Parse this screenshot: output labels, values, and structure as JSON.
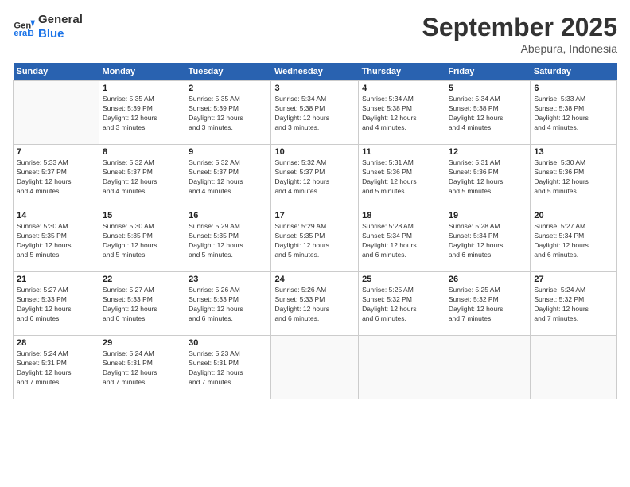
{
  "logo": {
    "line1": "General",
    "line2": "Blue"
  },
  "title": "September 2025",
  "subtitle": "Abepura, Indonesia",
  "days_of_week": [
    "Sunday",
    "Monday",
    "Tuesday",
    "Wednesday",
    "Thursday",
    "Friday",
    "Saturday"
  ],
  "weeks": [
    [
      {
        "day": "",
        "info": ""
      },
      {
        "day": "1",
        "info": "Sunrise: 5:35 AM\nSunset: 5:39 PM\nDaylight: 12 hours\nand 3 minutes."
      },
      {
        "day": "2",
        "info": "Sunrise: 5:35 AM\nSunset: 5:39 PM\nDaylight: 12 hours\nand 3 minutes."
      },
      {
        "day": "3",
        "info": "Sunrise: 5:34 AM\nSunset: 5:38 PM\nDaylight: 12 hours\nand 3 minutes."
      },
      {
        "day": "4",
        "info": "Sunrise: 5:34 AM\nSunset: 5:38 PM\nDaylight: 12 hours\nand 4 minutes."
      },
      {
        "day": "5",
        "info": "Sunrise: 5:34 AM\nSunset: 5:38 PM\nDaylight: 12 hours\nand 4 minutes."
      },
      {
        "day": "6",
        "info": "Sunrise: 5:33 AM\nSunset: 5:38 PM\nDaylight: 12 hours\nand 4 minutes."
      }
    ],
    [
      {
        "day": "7",
        "info": "Sunrise: 5:33 AM\nSunset: 5:37 PM\nDaylight: 12 hours\nand 4 minutes."
      },
      {
        "day": "8",
        "info": "Sunrise: 5:32 AM\nSunset: 5:37 PM\nDaylight: 12 hours\nand 4 minutes."
      },
      {
        "day": "9",
        "info": "Sunrise: 5:32 AM\nSunset: 5:37 PM\nDaylight: 12 hours\nand 4 minutes."
      },
      {
        "day": "10",
        "info": "Sunrise: 5:32 AM\nSunset: 5:37 PM\nDaylight: 12 hours\nand 4 minutes."
      },
      {
        "day": "11",
        "info": "Sunrise: 5:31 AM\nSunset: 5:36 PM\nDaylight: 12 hours\nand 5 minutes."
      },
      {
        "day": "12",
        "info": "Sunrise: 5:31 AM\nSunset: 5:36 PM\nDaylight: 12 hours\nand 5 minutes."
      },
      {
        "day": "13",
        "info": "Sunrise: 5:30 AM\nSunset: 5:36 PM\nDaylight: 12 hours\nand 5 minutes."
      }
    ],
    [
      {
        "day": "14",
        "info": "Sunrise: 5:30 AM\nSunset: 5:35 PM\nDaylight: 12 hours\nand 5 minutes."
      },
      {
        "day": "15",
        "info": "Sunrise: 5:30 AM\nSunset: 5:35 PM\nDaylight: 12 hours\nand 5 minutes."
      },
      {
        "day": "16",
        "info": "Sunrise: 5:29 AM\nSunset: 5:35 PM\nDaylight: 12 hours\nand 5 minutes."
      },
      {
        "day": "17",
        "info": "Sunrise: 5:29 AM\nSunset: 5:35 PM\nDaylight: 12 hours\nand 5 minutes."
      },
      {
        "day": "18",
        "info": "Sunrise: 5:28 AM\nSunset: 5:34 PM\nDaylight: 12 hours\nand 6 minutes."
      },
      {
        "day": "19",
        "info": "Sunrise: 5:28 AM\nSunset: 5:34 PM\nDaylight: 12 hours\nand 6 minutes."
      },
      {
        "day": "20",
        "info": "Sunrise: 5:27 AM\nSunset: 5:34 PM\nDaylight: 12 hours\nand 6 minutes."
      }
    ],
    [
      {
        "day": "21",
        "info": "Sunrise: 5:27 AM\nSunset: 5:33 PM\nDaylight: 12 hours\nand 6 minutes."
      },
      {
        "day": "22",
        "info": "Sunrise: 5:27 AM\nSunset: 5:33 PM\nDaylight: 12 hours\nand 6 minutes."
      },
      {
        "day": "23",
        "info": "Sunrise: 5:26 AM\nSunset: 5:33 PM\nDaylight: 12 hours\nand 6 minutes."
      },
      {
        "day": "24",
        "info": "Sunrise: 5:26 AM\nSunset: 5:33 PM\nDaylight: 12 hours\nand 6 minutes."
      },
      {
        "day": "25",
        "info": "Sunrise: 5:25 AM\nSunset: 5:32 PM\nDaylight: 12 hours\nand 6 minutes."
      },
      {
        "day": "26",
        "info": "Sunrise: 5:25 AM\nSunset: 5:32 PM\nDaylight: 12 hours\nand 7 minutes."
      },
      {
        "day": "27",
        "info": "Sunrise: 5:24 AM\nSunset: 5:32 PM\nDaylight: 12 hours\nand 7 minutes."
      }
    ],
    [
      {
        "day": "28",
        "info": "Sunrise: 5:24 AM\nSunset: 5:31 PM\nDaylight: 12 hours\nand 7 minutes."
      },
      {
        "day": "29",
        "info": "Sunrise: 5:24 AM\nSunset: 5:31 PM\nDaylight: 12 hours\nand 7 minutes."
      },
      {
        "day": "30",
        "info": "Sunrise: 5:23 AM\nSunset: 5:31 PM\nDaylight: 12 hours\nand 7 minutes."
      },
      {
        "day": "",
        "info": ""
      },
      {
        "day": "",
        "info": ""
      },
      {
        "day": "",
        "info": ""
      },
      {
        "day": "",
        "info": ""
      }
    ]
  ]
}
